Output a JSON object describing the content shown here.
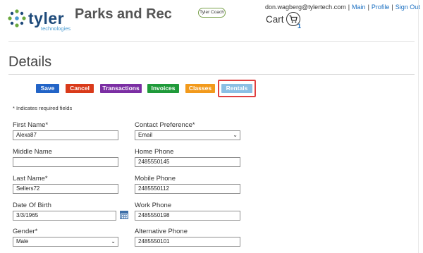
{
  "header": {
    "logo_text": "tyler",
    "logo_sub": "technologies",
    "app_title": "Parks and Rec",
    "coach_badge": "Tyler Coach",
    "user_email": "don.wagberg@tylertech.com",
    "separator": "|",
    "links": [
      "Main",
      "Profile",
      "Sign Out"
    ],
    "cart_label": "Cart",
    "cart_count": "1"
  },
  "page": {
    "title": "Details",
    "required_note": "* Indicates required fields"
  },
  "buttons": {
    "save": "Save",
    "cancel": "Cancel",
    "transactions": "Transactions",
    "invoices": "Invoices",
    "classes": "Classes",
    "rentals": "Rentals"
  },
  "form": {
    "first_name": {
      "label": "First Name*",
      "value": "Alexa87"
    },
    "middle_name": {
      "label": "Middle Name",
      "value": ""
    },
    "last_name": {
      "label": "Last Name*",
      "value": "Sellers72"
    },
    "date_of_birth": {
      "label": "Date Of Birth",
      "value": "3/3/1965"
    },
    "gender": {
      "label": "Gender*",
      "value": "Male"
    },
    "contact_preference": {
      "label": "Contact Preference*",
      "value": "Email"
    },
    "home_phone": {
      "label": "Home Phone",
      "value": "2485550145"
    },
    "mobile_phone": {
      "label": "Mobile Phone",
      "value": "2485550112"
    },
    "work_phone": {
      "label": "Work Phone",
      "value": "2485550198"
    },
    "alternative_phone": {
      "label": "Alternative Phone",
      "value": "2485550101"
    }
  },
  "colors": {
    "save": "#2264c7",
    "cancel": "#d93a1a",
    "transactions": "#7b2ea3",
    "invoices": "#1f9a3a",
    "classes": "#f29a1c",
    "rentals": "#8bbfe4",
    "highlight": "#e04040",
    "link": "#1a6fc1"
  }
}
